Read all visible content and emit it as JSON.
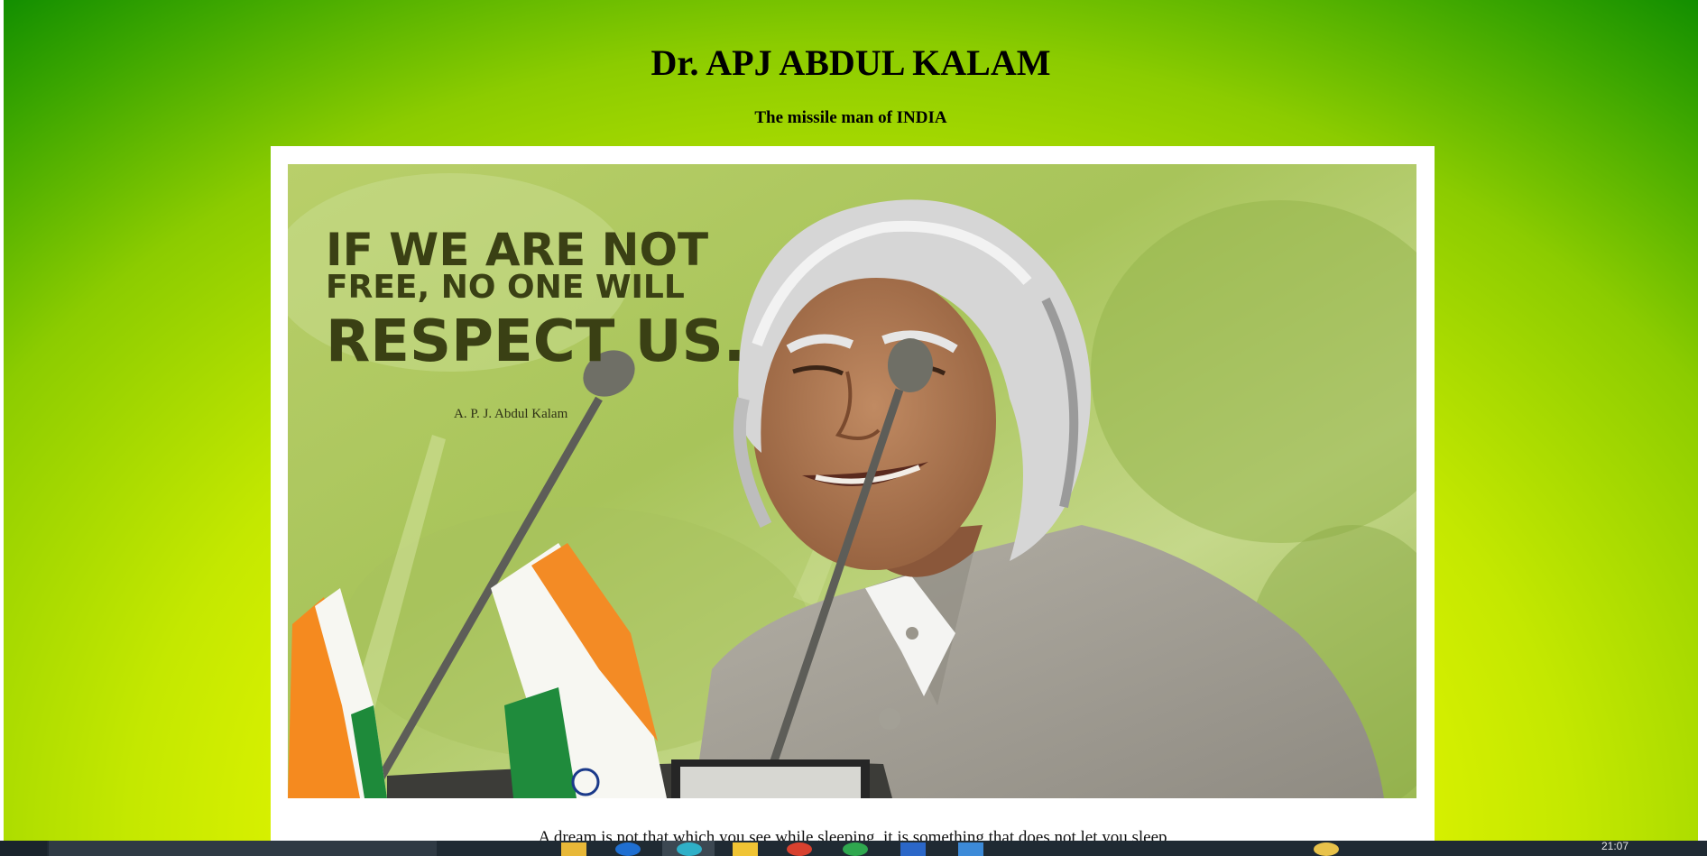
{
  "page": {
    "title": "Dr. APJ ABDUL KALAM",
    "subtitle": "The missile man of INDIA",
    "caption": "A dream is not that which you see while sleeping, it is something that does not let you sleep"
  },
  "photo": {
    "quote_line1": "IF WE ARE NOT",
    "quote_line2": "FREE, NO ONE WILL",
    "quote_line3": "RESPECT US.",
    "attribution": "A. P. J. Abdul Kalam"
  },
  "taskbar": {
    "clock": "21:07"
  },
  "colors": {
    "background_center": "#ffff00",
    "background_edge": "#0e8c00",
    "quote_text": "#3a4014"
  }
}
